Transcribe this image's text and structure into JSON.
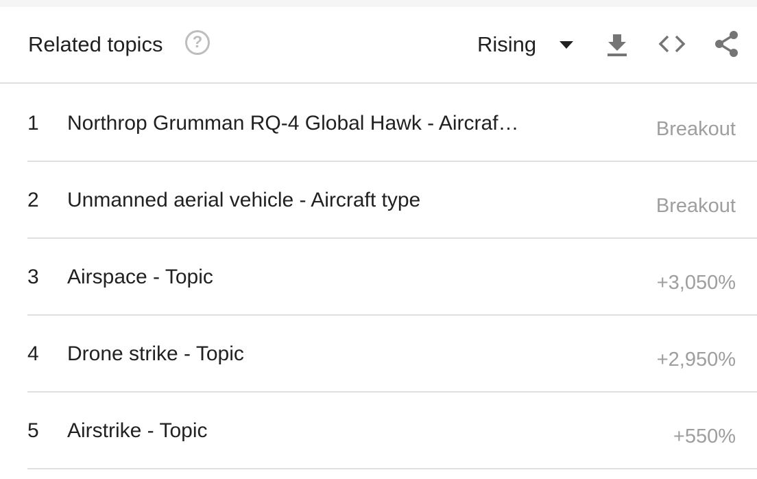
{
  "header": {
    "title": "Related topics",
    "help_icon": "help-circle-icon",
    "filter": {
      "selected": "Rising",
      "caret_icon": "caret-down-icon"
    },
    "tools": {
      "download_icon": "download-icon",
      "embed_icon": "code-icon",
      "share_icon": "share-icon"
    }
  },
  "rows": [
    {
      "rank": "1",
      "topic": "Northrop Grumman RQ-4 Global Hawk - Aircraf…",
      "value": "Breakout"
    },
    {
      "rank": "2",
      "topic": "Unmanned aerial vehicle - Aircraft type",
      "value": "Breakout"
    },
    {
      "rank": "3",
      "topic": "Airspace - Topic",
      "value": "+3,050%"
    },
    {
      "rank": "4",
      "topic": "Drone strike - Topic",
      "value": "+2,950%"
    },
    {
      "rank": "5",
      "topic": "Airstrike - Topic",
      "value": "+550%"
    }
  ],
  "colors": {
    "text": "#212121",
    "muted": "#9e9e9e",
    "icon": "#757575",
    "divider": "#e0e0e0"
  }
}
